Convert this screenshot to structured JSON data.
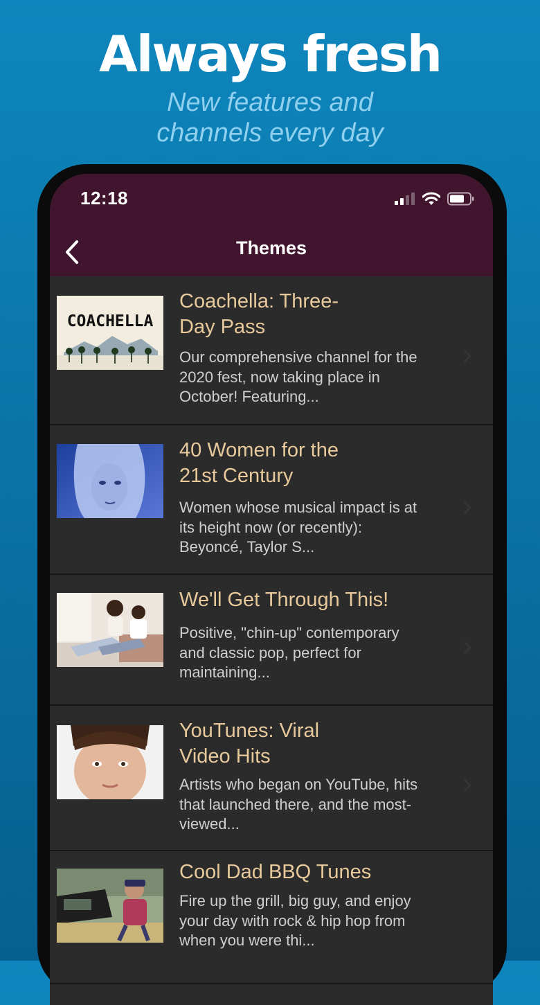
{
  "promo": {
    "title": "Always fresh",
    "subtitle": "New features and\nchannels every day"
  },
  "status_bar": {
    "time": "12:18"
  },
  "nav": {
    "title": "Themes"
  },
  "colors": {
    "background": "#0a74a8",
    "header": "#42152e",
    "list_bg": "#2b2b2b",
    "title_text": "#e8c99c",
    "desc_text": "#cfcfcf"
  },
  "themes": [
    {
      "title": "Coachella: Three-\nDay Pass",
      "description": "Our comprehensive channel for the 2020 fest, now taking place in October! Featuring...",
      "thumb_text": "COACHELLA"
    },
    {
      "title": "40 Women for the\n21st Century",
      "description": "Women whose musical impact is at its height now (or recently): Beyoncé, Taylor S..."
    },
    {
      "title": "We'll Get Through This!",
      "description": "Positive, \"chin-up\" contemporary and classic pop, perfect for maintaining..."
    },
    {
      "title": "YouTunes: Viral\nVideo Hits",
      "description": "Artists who began on YouTube, hits that launched there, and the most-viewed..."
    },
    {
      "title": "Cool Dad BBQ Tunes",
      "description": "Fire up the grill, big guy, and enjoy your day with rock & hip hop from when you were thi..."
    }
  ],
  "icons": [
    "back-chevron-icon",
    "signal-icon",
    "wifi-icon",
    "battery-icon",
    "chevron-right-icon"
  ]
}
